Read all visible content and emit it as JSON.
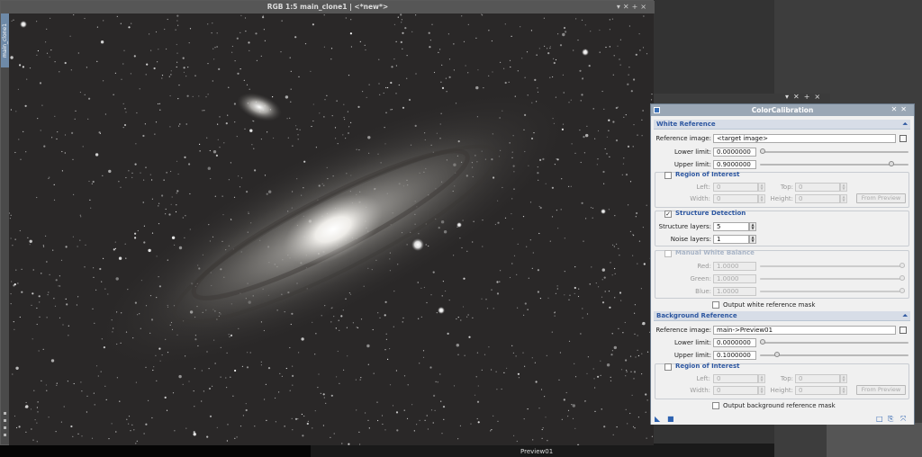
{
  "image_window": {
    "title": "RGB 1:5 main_clone1 | <*new*>",
    "side_tab": "main_clone1",
    "title_buttons": [
      "▾",
      "✕",
      "+",
      "×"
    ]
  },
  "bottom_strip": {
    "preview_label": "Preview01"
  },
  "dialog_top_buttons": [
    "▾",
    "✕",
    "+",
    "×"
  ],
  "color_calibration": {
    "title": "ColorCalibration",
    "title_buttons": [
      "✕",
      "✕"
    ],
    "white_reference": {
      "header": "White Reference",
      "reference_image_label": "Reference image:",
      "reference_image_value": "<target image>",
      "lower_limit_label": "Lower limit:",
      "lower_limit_value": "0.0000000",
      "lower_limit_fraction": 0.0,
      "upper_limit_label": "Upper limit:",
      "upper_limit_value": "0.9000000",
      "upper_limit_fraction": 0.9,
      "roi": {
        "label": "Region of Interest",
        "checked": false,
        "left_label": "Left:",
        "left_value": "0",
        "top_label": "Top:",
        "top_value": "0",
        "width_label": "Width:",
        "width_value": "0",
        "height_label": "Height:",
        "height_value": "0",
        "from_preview": "From Preview"
      },
      "structure_detection": {
        "label": "Structure Detection",
        "checked": true,
        "structure_layers_label": "Structure layers:",
        "structure_layers_value": "5",
        "noise_layers_label": "Noise layers:",
        "noise_layers_value": "1"
      },
      "manual_white_balance": {
        "label": "Manual White Balance",
        "checked": false,
        "red_label": "Red:",
        "red_value": "1.0000",
        "green_label": "Green:",
        "green_value": "1.0000",
        "blue_label": "Blue:",
        "blue_value": "1.0000"
      },
      "output_mask_label": "Output white reference mask"
    },
    "background_reference": {
      "header": "Background Reference",
      "reference_image_label": "Reference image:",
      "reference_image_value": "main->Preview01",
      "lower_limit_label": "Lower limit:",
      "lower_limit_value": "0.0000000",
      "lower_limit_fraction": 0.0,
      "upper_limit_label": "Upper limit:",
      "upper_limit_value": "0.1000000",
      "upper_limit_fraction": 0.1,
      "roi": {
        "label": "Region of Interest",
        "checked": false,
        "left_label": "Left:",
        "left_value": "0",
        "top_label": "Top:",
        "top_value": "0",
        "width_label": "Width:",
        "width_value": "0",
        "height_label": "Height:",
        "height_value": "0",
        "from_preview": "From Preview"
      },
      "output_mask_label": "Output background reference mask"
    },
    "colors": {
      "section_header_text": "#2c56a0",
      "title_bar": "#9aa7b5",
      "panel_bg": "#f0f0f0"
    }
  }
}
